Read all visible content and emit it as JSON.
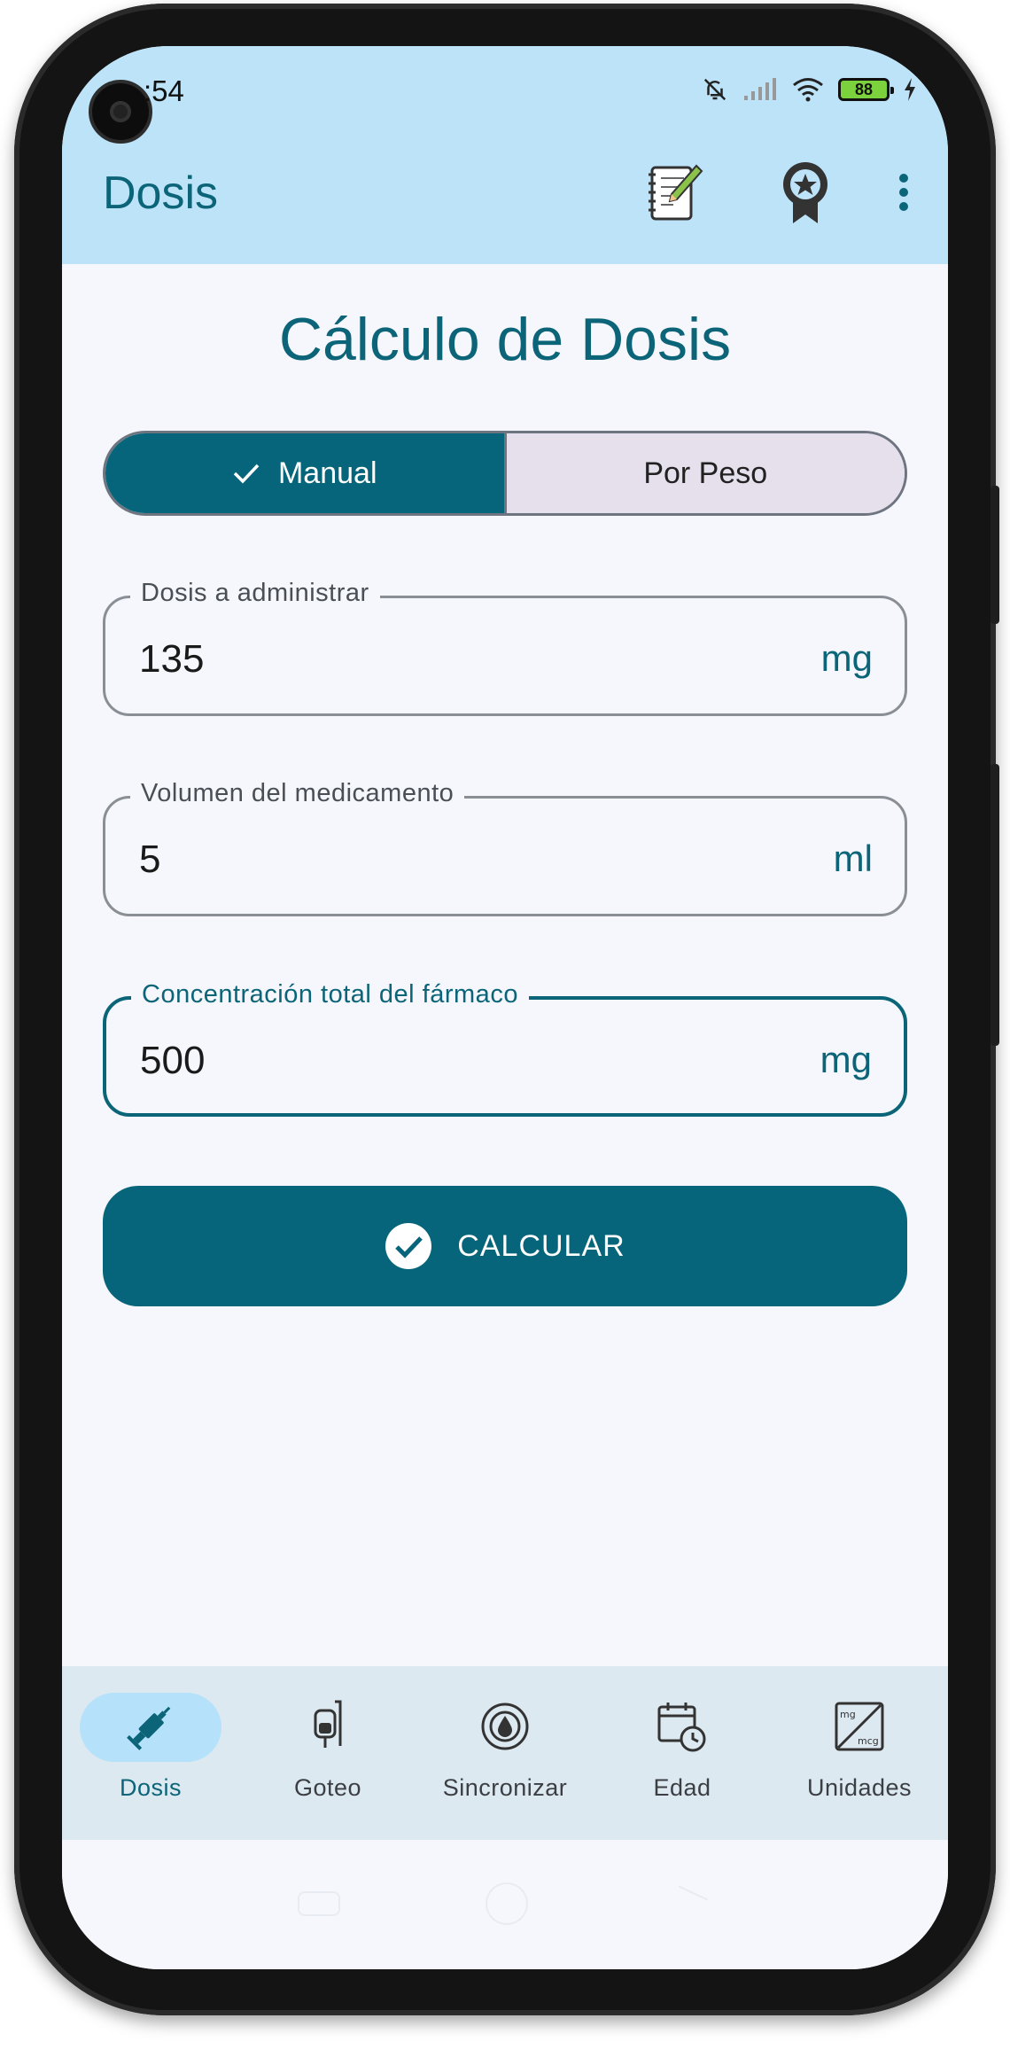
{
  "status_bar": {
    "time": ":54",
    "battery": "88"
  },
  "app_bar": {
    "title": "Dosis",
    "icons": [
      "notes-icon",
      "award-icon",
      "more-vert-icon"
    ]
  },
  "page": {
    "title": "Cálculo de Dosis"
  },
  "mode_toggle": {
    "options": [
      {
        "label": "Manual",
        "selected": true
      },
      {
        "label": "Por Peso",
        "selected": false
      }
    ]
  },
  "fields": {
    "dose": {
      "label": "Dosis a administrar",
      "value": "135",
      "unit": "mg"
    },
    "volume": {
      "label": "Volumen del medicamento",
      "value": "5",
      "unit": "ml"
    },
    "concentration": {
      "label": "Concentración total del fármaco",
      "value": "500",
      "unit": "mg",
      "focused": true
    }
  },
  "actions": {
    "calculate_label": "CALCULAR"
  },
  "bottom_nav": {
    "items": [
      {
        "label": "Dosis",
        "icon": "syringe-icon",
        "active": true
      },
      {
        "label": "Goteo",
        "icon": "iv-bag-icon",
        "active": false
      },
      {
        "label": "Sincronizar",
        "icon": "drop-sync-icon",
        "active": false
      },
      {
        "label": "Edad",
        "icon": "calendar-clock-icon",
        "active": false
      },
      {
        "label": "Unidades",
        "icon": "mg-mcg-convert-icon",
        "active": false
      }
    ]
  },
  "colors": {
    "primary": "#06657a",
    "app_bar_bg": "#bde3f8",
    "nav_bg": "#dde9f0",
    "active_pill": "#b5e2fa"
  }
}
